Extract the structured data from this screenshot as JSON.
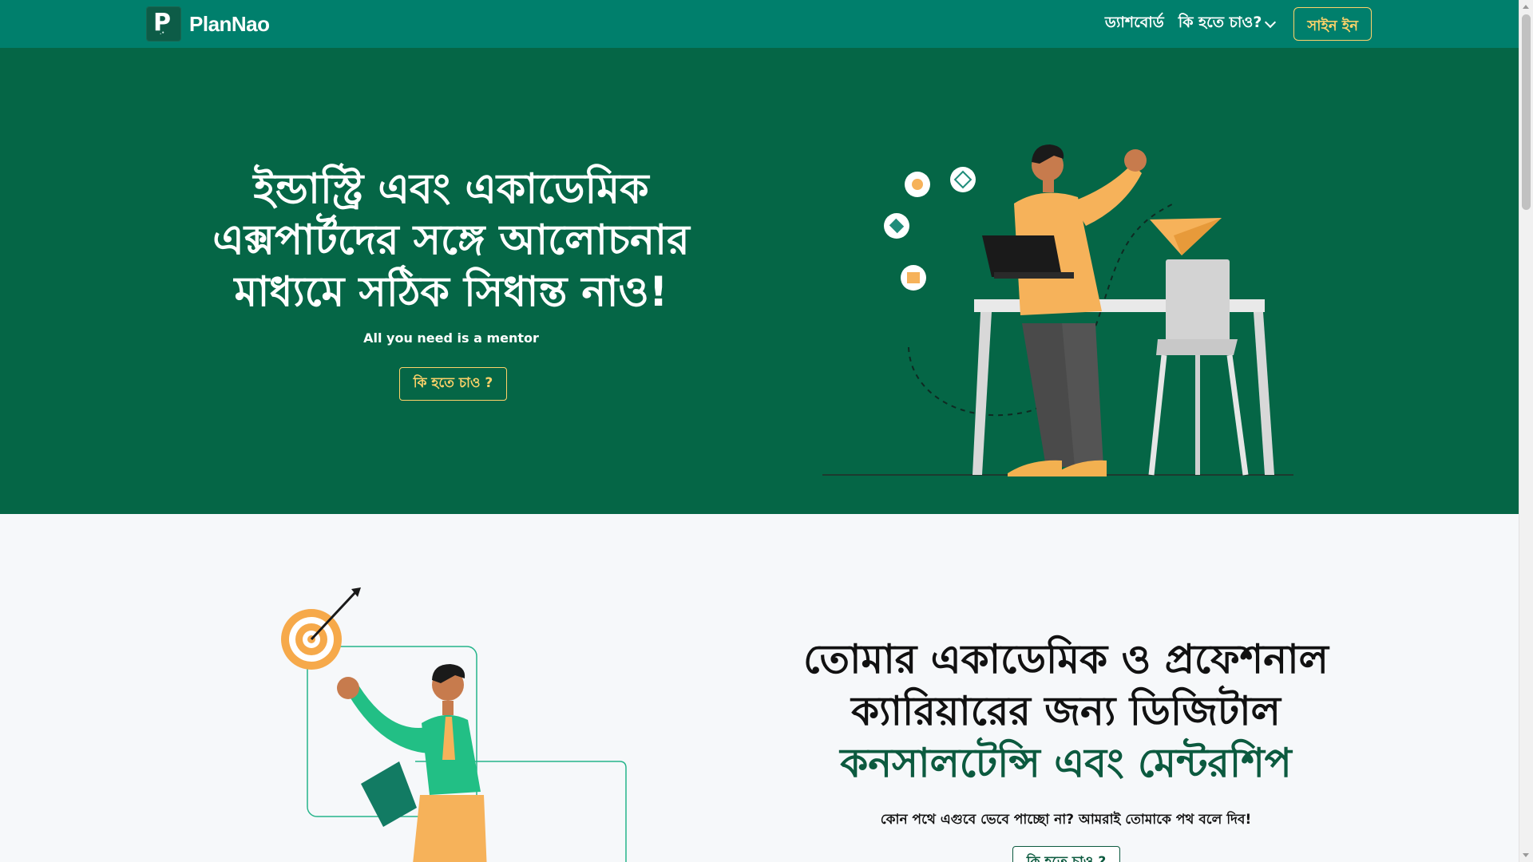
{
  "header": {
    "brand_name": "PlanNao",
    "logo_letter": "P",
    "nav": {
      "dashboard": "ড্যাশবোর্ড",
      "what_to_become": "কি হতে চাও?",
      "signin": "সাইন ইন"
    }
  },
  "hero": {
    "title": "ইন্ডাস্ট্রি এবং একাডেমিক এক্সপার্টদের সঙ্গে আলোচনার মাধ্যমে সঠিক সিধান্ত নাও!",
    "subtitle": "All you need is a mentor",
    "cta": "কি হতে চাও ?"
  },
  "section2": {
    "title_line1": "তোমার একাডেমিক ও প্রফেশনাল",
    "title_line2": "ক্যারিয়ারের জন্য ডিজিটাল",
    "title_accent": "কনসালটেন্সি এবং মেন্টরশিপ",
    "subtitle": "কোন পথে এগুবে ভেবে পাচ্ছো না? আমরাই তোমাকে পথ বলে দিব!",
    "cta": "কি হতে চাও ?"
  },
  "colors": {
    "navbar": "#007f6c",
    "hero_bg": "#056646",
    "accent_yellow": "#ffd36a",
    "accent_green_text": "#0c5a3f",
    "page_bg": "#f6f8fa"
  },
  "icons": [
    "logo-icon",
    "chevron-down-icon",
    "lightbulb-icon",
    "diamond-icon",
    "tag-icon",
    "bank-icon",
    "paper-plane-icon",
    "target-icon",
    "arrow-icon"
  ]
}
